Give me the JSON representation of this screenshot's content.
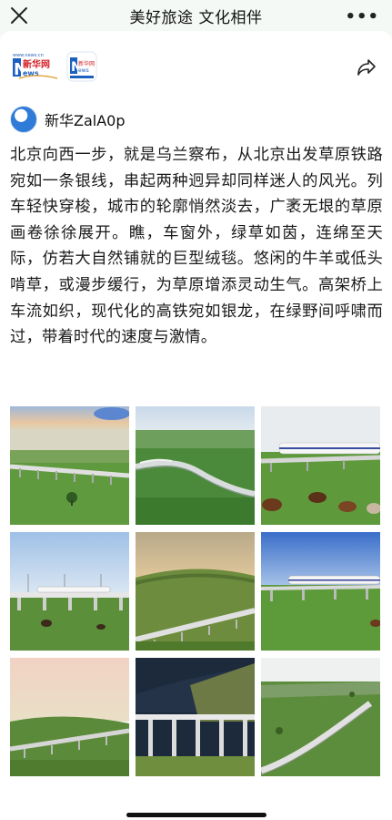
{
  "header": {
    "title": "美好旅途 文化相伴",
    "close_icon": "close-icon",
    "more_icon": "more-icon",
    "more_glyph": "•••"
  },
  "logos": {
    "xinhua_site": "www.news.cn",
    "xinhua_cn": "新华网",
    "xinhua_en": "News",
    "app_cn": "新华网",
    "app_en": "XINHUANET"
  },
  "share_icon": "share-icon",
  "author": {
    "name": "新华ZalA0p"
  },
  "article": {
    "text": "北京向西一步，就是乌兰察布，从北京出发草原铁路宛如一条银线，串起两种迥异却同样迷人的风光。列车轻快穿梭，城市的轮廓悄然淡去，广袤无垠的草原画卷徐徐展开。瞧，车窗外，绿草如茵，连绵至天际，仿若大自然铺就的巨型绒毯。悠闲的牛羊或低头啃草，或漫步缓行，为草原增添灵动生气。高架桥上车流如织，现代化的高铁宛如银龙，在绿野间呼啸而过，带着时代的速度与激情。"
  },
  "gallery": {
    "photos": [
      "viaduct-sunset-green-field",
      "curved-viaduct-aerial",
      "high-speed-train-cattle-grazing",
      "train-viaduct-blue-sky",
      "viaduct-golden-hill",
      "train-viaduct-meadow-cow",
      "viaduct-pink-sky",
      "tall-pier-bridge-night",
      "curved-viaduct-grassland"
    ]
  },
  "colors": {
    "background": "#f4f9f5",
    "card": "#ffffff",
    "text": "#1a1a1a",
    "avatar_blue": "#2f7bd8"
  }
}
